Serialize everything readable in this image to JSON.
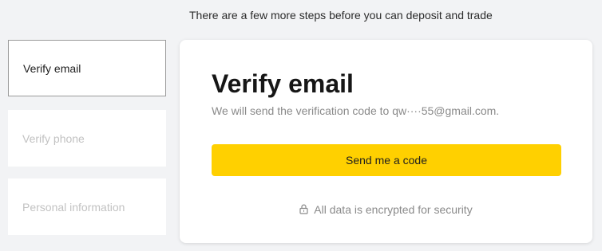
{
  "header": {
    "message": "There are a few more steps before you can deposit and trade"
  },
  "steps": [
    {
      "label": "Verify email",
      "state": "active"
    },
    {
      "label": "Verify phone",
      "state": "inactive"
    },
    {
      "label": "Personal information",
      "state": "inactive"
    }
  ],
  "card": {
    "title": "Verify email",
    "subtitle": "We will send the verification code to qw····55@gmail.com.",
    "button_label": "Send me a code",
    "security_text": "All data is encrypted for security",
    "security_icon": "lock-icon"
  },
  "colors": {
    "accent": "#ffd000",
    "page_background": "#f2f3f5",
    "card_background": "#ffffff",
    "muted_text": "#8a8a8a",
    "inactive_step_text": "#c2c2c2"
  }
}
